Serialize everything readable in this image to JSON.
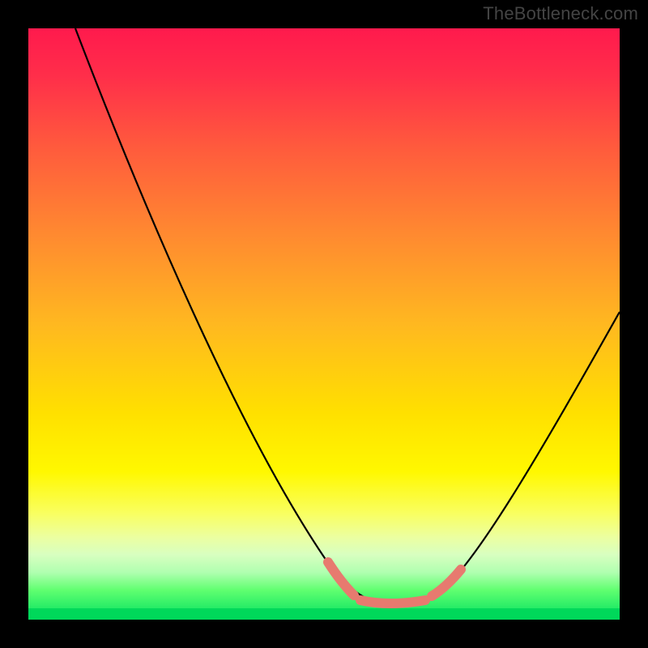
{
  "watermark": "TheBottleneck.com",
  "colors": {
    "gradient_top": "#ff1a4d",
    "gradient_mid": "#ffe000",
    "gradient_bottom": "#00e060",
    "curve": "#000000",
    "highlight": "#e77a6f",
    "frame": "#000000"
  },
  "chart_data": {
    "type": "line",
    "title": "",
    "xlabel": "",
    "ylabel": "",
    "xlim": [
      0,
      100
    ],
    "ylim": [
      0,
      100
    ],
    "grid": false,
    "legend": false,
    "series": [
      {
        "name": "bottleneck-curve",
        "x": [
          8,
          15,
          25,
          35,
          45,
          51,
          55,
          59,
          63,
          67,
          70,
          75,
          83,
          92,
          100
        ],
        "y": [
          100,
          82,
          58,
          38,
          20,
          10,
          5,
          3,
          2,
          3,
          6,
          12,
          28,
          46,
          62
        ]
      }
    ],
    "annotations": [
      {
        "name": "optimal-range-highlight",
        "x_range": [
          51,
          73
        ],
        "note": "salmon thick segments marking curve trough / best-match zone"
      }
    ],
    "background": "vertical heat gradient red→yellow→green (green = 0 bottleneck)"
  }
}
